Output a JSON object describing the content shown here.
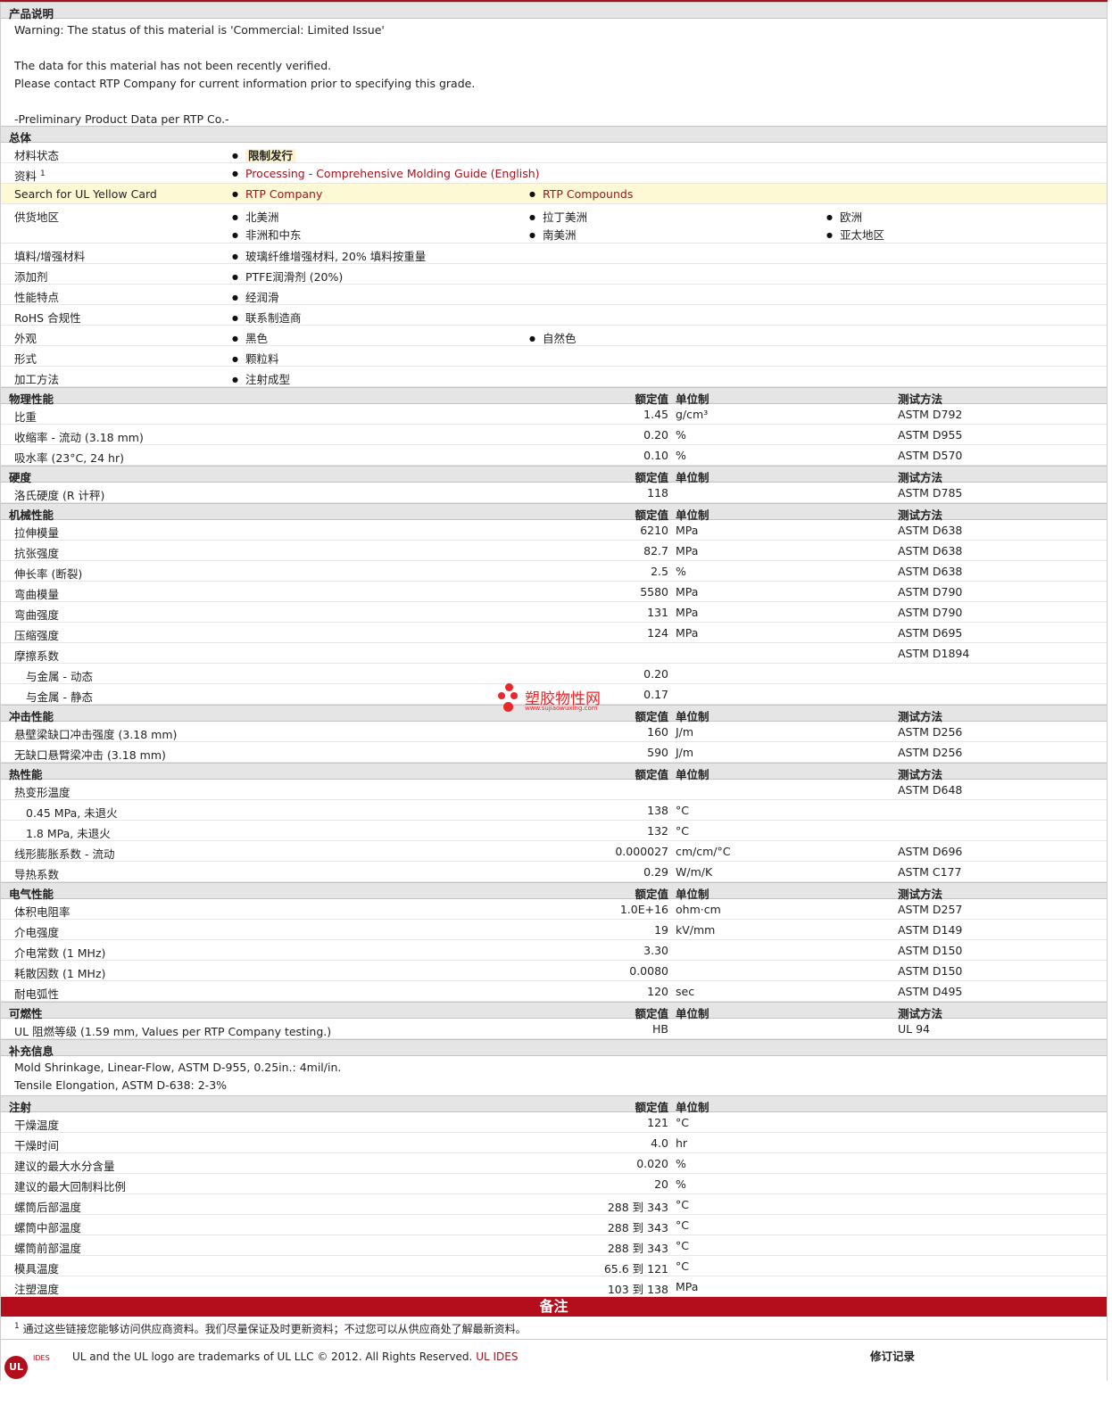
{
  "desc": {
    "title": "产品说明",
    "lines": [
      "Warning: The status of this material is 'Commercial: Limited Issue'",
      "",
      "The data for this material has not been recently verified.",
      "Please contact RTP Company for current information prior to specifying this grade.",
      "",
      "-Preliminary Product Data per RTP Co.-"
    ]
  },
  "general": {
    "title": "总体",
    "status_label": "材料状态",
    "status_value": "限制发行",
    "source_label": "资料",
    "source_sup": "1",
    "source_value": "Processing - Comprehensive Molding Guide (English)",
    "ul_label": "Search for UL Yellow Card",
    "ul_link1": "RTP Company",
    "ul_link2": "RTP Compounds",
    "region_label": "供货地区",
    "regions": [
      "北美洲",
      "拉丁美洲",
      "欧洲",
      "非洲和中东",
      "南美洲",
      "亚太地区"
    ],
    "filler_label": "填料/增强材料",
    "filler_value": "玻璃纤维增强材料, 20% 填料按重量",
    "additive_label": "添加剂",
    "additive_value": "PTFE润滑剂 (20%)",
    "feature_label": "性能特点",
    "feature_value": "经润滑",
    "rohs_label": "RoHS 合规性",
    "rohs_value": "联系制造商",
    "appearance_label": "外观",
    "appearance_1": "黑色",
    "appearance_2": "自然色",
    "form_label": "形式",
    "form_value": "颗粒料",
    "process_label": "加工方法",
    "process_value": "注射成型"
  },
  "hdr": {
    "value": "额定值",
    "unit": "单位制",
    "method": "测试方法"
  },
  "physical": {
    "title": "物理性能",
    "rows": [
      {
        "label": "比重",
        "value": "1.45",
        "unit": "g/cm³",
        "method": "ASTM D792"
      },
      {
        "label": "收缩率  - 流动  (3.18 mm)",
        "value": "0.20",
        "unit": "%",
        "method": "ASTM D955"
      },
      {
        "label": "吸水率  (23°C, 24 hr)",
        "value": "0.10",
        "unit": "%",
        "method": "ASTM D570"
      }
    ]
  },
  "hardness": {
    "title": "硬度",
    "rows": [
      {
        "label": "洛氏硬度  (R 计秤)",
        "value": "118",
        "unit": "",
        "method": "ASTM D785"
      }
    ]
  },
  "mechanical": {
    "title": "机械性能",
    "rows": [
      {
        "label": "拉伸模量",
        "value": "6210",
        "unit": "MPa",
        "method": "ASTM D638"
      },
      {
        "label": "抗张强度",
        "value": "82.7",
        "unit": "MPa",
        "method": "ASTM D638"
      },
      {
        "label": "伸长率  (断裂)",
        "value": "2.5",
        "unit": "%",
        "method": "ASTM D638"
      },
      {
        "label": "弯曲模量",
        "value": "5580",
        "unit": "MPa",
        "method": "ASTM D790"
      },
      {
        "label": "弯曲强度",
        "value": "131",
        "unit": "MPa",
        "method": "ASTM D790"
      },
      {
        "label": "压缩强度",
        "value": "124",
        "unit": "MPa",
        "method": "ASTM D695"
      },
      {
        "label": "摩擦系数",
        "value": "",
        "unit": "",
        "method": "ASTM D1894"
      },
      {
        "label": "与金属  - 动态",
        "value": "0.20",
        "unit": "",
        "method": "",
        "indent": true
      },
      {
        "label": "与金属  - 静态",
        "value": "0.17",
        "unit": "",
        "method": "",
        "indent": true
      }
    ]
  },
  "impact": {
    "title": "冲击性能",
    "rows": [
      {
        "label": "悬壁梁缺口冲击强度  (3.18 mm)",
        "value": "160",
        "unit": "J/m",
        "method": "ASTM D256"
      },
      {
        "label": "无缺口悬臂梁冲击  (3.18 mm)",
        "value": "590",
        "unit": "J/m",
        "method": "ASTM D256"
      }
    ]
  },
  "thermal": {
    "title": "热性能",
    "rows": [
      {
        "label": "热变形温度",
        "value": "",
        "unit": "",
        "method": "ASTM D648"
      },
      {
        "label": "0.45 MPa, 未退火",
        "value": "138",
        "unit": "°C",
        "method": "",
        "indent": true
      },
      {
        "label": "1.8 MPa, 未退火",
        "value": "132",
        "unit": "°C",
        "method": "",
        "indent": true
      },
      {
        "label": "线形膨胀系数  - 流动",
        "value": "0.000027",
        "unit": "cm/cm/°C",
        "method": "ASTM D696"
      },
      {
        "label": "导热系数",
        "value": "0.29",
        "unit": "W/m/K",
        "method": "ASTM C177"
      }
    ]
  },
  "electrical": {
    "title": "电气性能",
    "rows": [
      {
        "label": "体积电阻率",
        "value": "1.0E+16",
        "unit": "ohm·cm",
        "method": "ASTM D257"
      },
      {
        "label": "介电强度",
        "value": "19",
        "unit": "kV/mm",
        "method": "ASTM D149"
      },
      {
        "label": "介电常数  (1 MHz)",
        "value": "3.30",
        "unit": "",
        "method": "ASTM D150"
      },
      {
        "label": "耗散因数  (1 MHz)",
        "value": "0.0080",
        "unit": "",
        "method": "ASTM D150"
      },
      {
        "label": "耐电弧性",
        "value": "120",
        "unit": "sec",
        "method": "ASTM D495"
      }
    ]
  },
  "flammability": {
    "title": "可燃性",
    "rows": [
      {
        "label": "UL 阻燃等级  (1.59 mm, Values per RTP Company testing.)",
        "value": "HB",
        "unit": "",
        "method": "UL 94"
      }
    ]
  },
  "supplement": {
    "title": "补充信息",
    "lines": [
      "Mold Shrinkage, Linear-Flow, ASTM D-955, 0.25in.: 4mil/in.",
      "Tensile Elongation, ASTM D-638: 2-3%"
    ]
  },
  "injection": {
    "title": "注射",
    "rows": [
      {
        "label": "干燥温度",
        "value": "121",
        "unit": "°C"
      },
      {
        "label": "干燥时间",
        "value": "4.0",
        "unit": "hr"
      },
      {
        "label": "建议的最大水分含量",
        "value": "0.020",
        "unit": "%"
      },
      {
        "label": "建议的最大回制料比例",
        "value": "20",
        "unit": "%"
      },
      {
        "label": "螺筒后部温度",
        "value": "288 到  343",
        "unit": "°C"
      },
      {
        "label": "螺筒中部温度",
        "value": "288 到  343",
        "unit": "°C"
      },
      {
        "label": "螺筒前部温度",
        "value": "288 到  343",
        "unit": "°C"
      },
      {
        "label": "模具温度",
        "value": "65.6 到  121",
        "unit": "°C"
      },
      {
        "label": "注塑温度",
        "value": "103 到  138",
        "unit": "MPa"
      }
    ]
  },
  "notes": {
    "title": "备注",
    "sup": "1",
    "text": "通过这些链接您能够访问供应商资料。我们尽量保证及时更新资料；不过您可以从供应商处了解最新资料。"
  },
  "footer": {
    "ul_logo": "UL",
    "powered": "IDES",
    "trademark": "UL and the UL logo are trademarks of UL LLC © 2012. All Rights Reserved.",
    "ides_link": "UL IDES",
    "revision": "修订记录"
  },
  "watermark": {
    "name": "塑胶物性网",
    "url": "www.sujiaowuxing.com"
  }
}
